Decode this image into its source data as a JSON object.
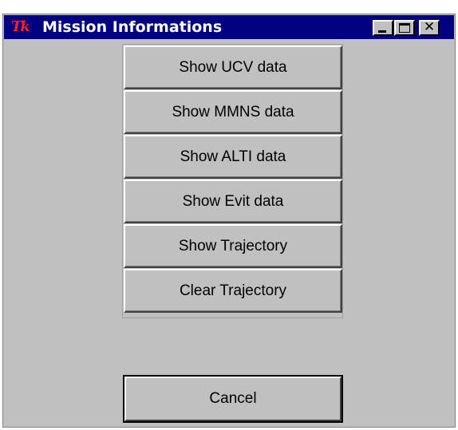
{
  "window": {
    "title": "Mission Informations",
    "icon_text": "Tk",
    "icon_name": "tk-feather-icon",
    "controls": {
      "minimize_icon": "minimize-icon",
      "maximize_icon": "maximize-icon",
      "close_symbol": "✕"
    }
  },
  "actions": [
    {
      "label": "Show UCV data"
    },
    {
      "label": "Show MMNS data"
    },
    {
      "label": "Show ALTI data"
    },
    {
      "label": "Show Evit data"
    },
    {
      "label": "Show Trajectory"
    },
    {
      "label": "Clear Trajectory"
    }
  ],
  "cancel_label": "Cancel",
  "colors": {
    "titlebar": "#000080",
    "face": "#c0c0c0",
    "icon_accent": "#ff2020"
  }
}
